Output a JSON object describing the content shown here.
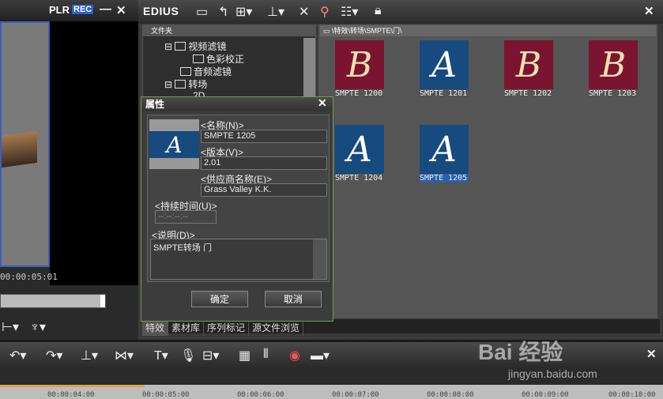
{
  "left_panel": {
    "plr_label": "PLR",
    "rec_label": "REC",
    "minimize": "—",
    "close": "✕",
    "timecode": "00:00:05:01"
  },
  "bin": {
    "title": "EDIUS",
    "close": "✕",
    "folder_header": "文件夹",
    "tree": [
      "视频滤镜",
      "色彩校正",
      "音频滤镜",
      "转场",
      "2D"
    ],
    "path": "\\特效\\转场\\SMPTE\\门\\",
    "thumbs": [
      {
        "letter": "B",
        "label": "SMPTE 1200",
        "color": "red"
      },
      {
        "letter": "A",
        "label": "SMPTE 1201",
        "color": "blue"
      },
      {
        "letter": "B",
        "label": "SMPTE 1202",
        "color": "red"
      },
      {
        "letter": "B",
        "label": "SMPTE 1203",
        "color": "red"
      },
      {
        "letter": "A",
        "label": "SMPTE 1204",
        "color": "blue"
      },
      {
        "letter": "A",
        "label": "SMPTE 1205",
        "color": "blue"
      }
    ],
    "tabs": [
      "特效",
      "素材库",
      "序列标记",
      "源文件浏览"
    ]
  },
  "dialog": {
    "title": "属性",
    "close": "✕",
    "thumb_letter": "A",
    "name_label": "<名称(N)>",
    "name_value": "SMPTE 1205",
    "version_label": "<版本(V)>",
    "version_value": "2.01",
    "vendor_label": "<供应商名称(E)>",
    "vendor_value": "Grass Valley K.K.",
    "duration_label": "<持续时间(U)>",
    "duration_value": "--:--:--:--",
    "desc_label": "<说明(D)>",
    "desc_value": "SMPTE转场 门",
    "ok": "确定",
    "cancel": "取消"
  },
  "bottom": {
    "close": "✕",
    "ruler": [
      "00:00:04:00",
      "00:00:05:00",
      "00:00:06:00",
      "00:00:07:00",
      "00:00:08:00",
      "00:00:09:00",
      "00:00:10:00"
    ]
  },
  "watermark": {
    "main": "Bai 经验",
    "sub": "jingyan.baidu.com"
  },
  "colors": {
    "accent": "#3b5fbf",
    "thumb_red": "#7a1430",
    "thumb_blue": "#174a7e",
    "dialog_border": "#6fa050"
  }
}
